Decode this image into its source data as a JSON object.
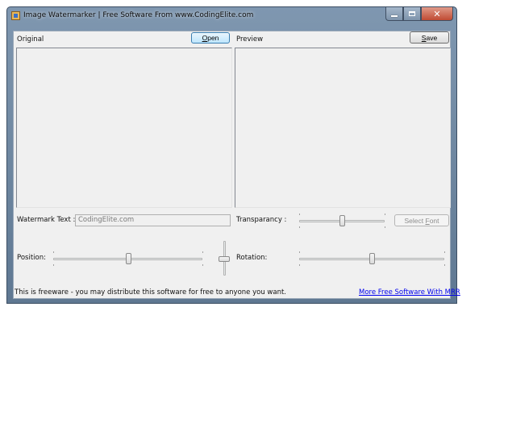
{
  "window": {
    "title": "Image Watermarker | Free Software From www.CodingElite.com"
  },
  "labels": {
    "original": "Original",
    "preview": "Preview",
    "watermark_text": "Watermark Text :",
    "transparancy": "Transparancy :",
    "position": "Position:",
    "rotation": "Rotation:"
  },
  "buttons": {
    "open": {
      "mnemonic": "O",
      "rest": "pen"
    },
    "save": {
      "mnemonic": "S",
      "rest": "ave"
    },
    "select_font": {
      "pre": "Select ",
      "mnemonic": "F",
      "rest": "ont"
    }
  },
  "watermark_input": {
    "value": "CodingElite.com"
  },
  "sliders": {
    "position_level": 0.5,
    "transparancy_level": 0.5,
    "rotation_level": 0.5,
    "vertical_level": 0.5
  },
  "footer": {
    "notice": "This is freeware - you may distribute this software for free to anyone you want.",
    "link": "More Free Software With MRR"
  },
  "colors": {
    "link": "#0000ee",
    "title_bar": "#6f89a5",
    "close_button": "#c75a44"
  }
}
